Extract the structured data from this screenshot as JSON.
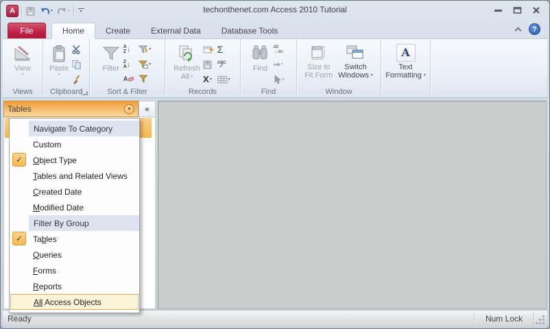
{
  "titlebar": {
    "title": "techonthenet.com Access 2010 Tutorial",
    "app_icon_letter": "A",
    "qat_icons": [
      "access-logo-icon",
      "save-icon",
      "undo-icon",
      "redo-icon",
      "customize-quick-access-toolbar-icon"
    ],
    "window_controls": [
      "minimize",
      "restore",
      "close"
    ]
  },
  "tabs": {
    "file": "File",
    "items": [
      "Home",
      "Create",
      "External Data",
      "Database Tools"
    ],
    "active": "Home"
  },
  "ribbon": {
    "views": {
      "label": "Views",
      "view": "View",
      "icon": "design-view-icon"
    },
    "clipboard": {
      "label": "Clipboard",
      "paste": "Paste",
      "small_icons": [
        "scissors-icon",
        "copy-icon",
        "format-painter-icon"
      ],
      "dialog_launcher": true
    },
    "sort_filter": {
      "label": "Sort & Filter",
      "filter": "Filter",
      "sort_a": "A",
      "sort_z": "Z",
      "small_icons": [
        "sort-ascending-icon",
        "sort-descending-icon",
        "remove-sort-icon",
        "filter-selection-icon",
        "filter-advanced-icon",
        "filter-toggle-icon"
      ]
    },
    "records": {
      "label": "Records",
      "refresh_line1": "Refresh",
      "refresh_line2": "All",
      "spelling_text": "ABC",
      "delete_x": "X",
      "small_icons": [
        "new-record-icon",
        "save-record-icon",
        "delete-x-icon",
        "totals-sigma-icon",
        "spelling-check-icon",
        "more-grid-icon"
      ]
    },
    "find": {
      "label": "Find",
      "find": "Find",
      "replace_top": "ab",
      "replace_bottom": "→ac",
      "small_icons": [
        "replace-icon",
        "go-to-icon",
        "select-cursor-icon"
      ]
    },
    "window": {
      "label": "Window",
      "size_line1": "Size to",
      "size_line2": "Fit Form",
      "switch_line1": "Switch",
      "switch_line2": "Windows"
    },
    "text_formatting": {
      "line1": "Text",
      "line2": "Formatting",
      "letter": "A",
      "icon": "letter-a-icon"
    }
  },
  "nav_pane": {
    "header": "Tables",
    "dropdown_icon": "chevron-down-circle-icon",
    "collapse_glyph": "«"
  },
  "nav_menu": {
    "items": [
      {
        "type": "header",
        "label": "Navigate To Category"
      },
      {
        "type": "item",
        "pre": "Custom"
      },
      {
        "type": "item",
        "checked": true,
        "key": "O",
        "post": "bject Type"
      },
      {
        "type": "item",
        "key": "T",
        "post": "ables and Related Views"
      },
      {
        "type": "item",
        "key": "C",
        "post": "reated Date"
      },
      {
        "type": "item",
        "key": "M",
        "post": "odified Date"
      },
      {
        "type": "header",
        "label": "Filter By Group"
      },
      {
        "type": "item",
        "checked": true,
        "pre": "Ta",
        "key": "b",
        "post": "les"
      },
      {
        "type": "item",
        "key": "Q",
        "post": "ueries"
      },
      {
        "type": "item",
        "key": "F",
        "post": "orms"
      },
      {
        "type": "item",
        "key": "R",
        "post": "eports"
      },
      {
        "type": "item",
        "highlighted": true,
        "key": "All",
        "post": " Access Objects"
      }
    ]
  },
  "status_bar": {
    "left": "Ready",
    "right": "Num Lock"
  },
  "glyphs": {
    "dropdown": "▾",
    "dropdown_large": "▼",
    "check": "✓",
    "sigma": "Σ",
    "goto_arrow": "⇒",
    "down_arrow": "↓",
    "help": "?"
  },
  "colors": {
    "nav_header_orange": "#F5A843",
    "check_orange": "#F8C25F",
    "highlight_cream": "#FCF4D8",
    "file_tab_red": "#C22653",
    "workspace_gray": "#C9CDCB",
    "menu_header_bg": "#DFE3EF"
  }
}
